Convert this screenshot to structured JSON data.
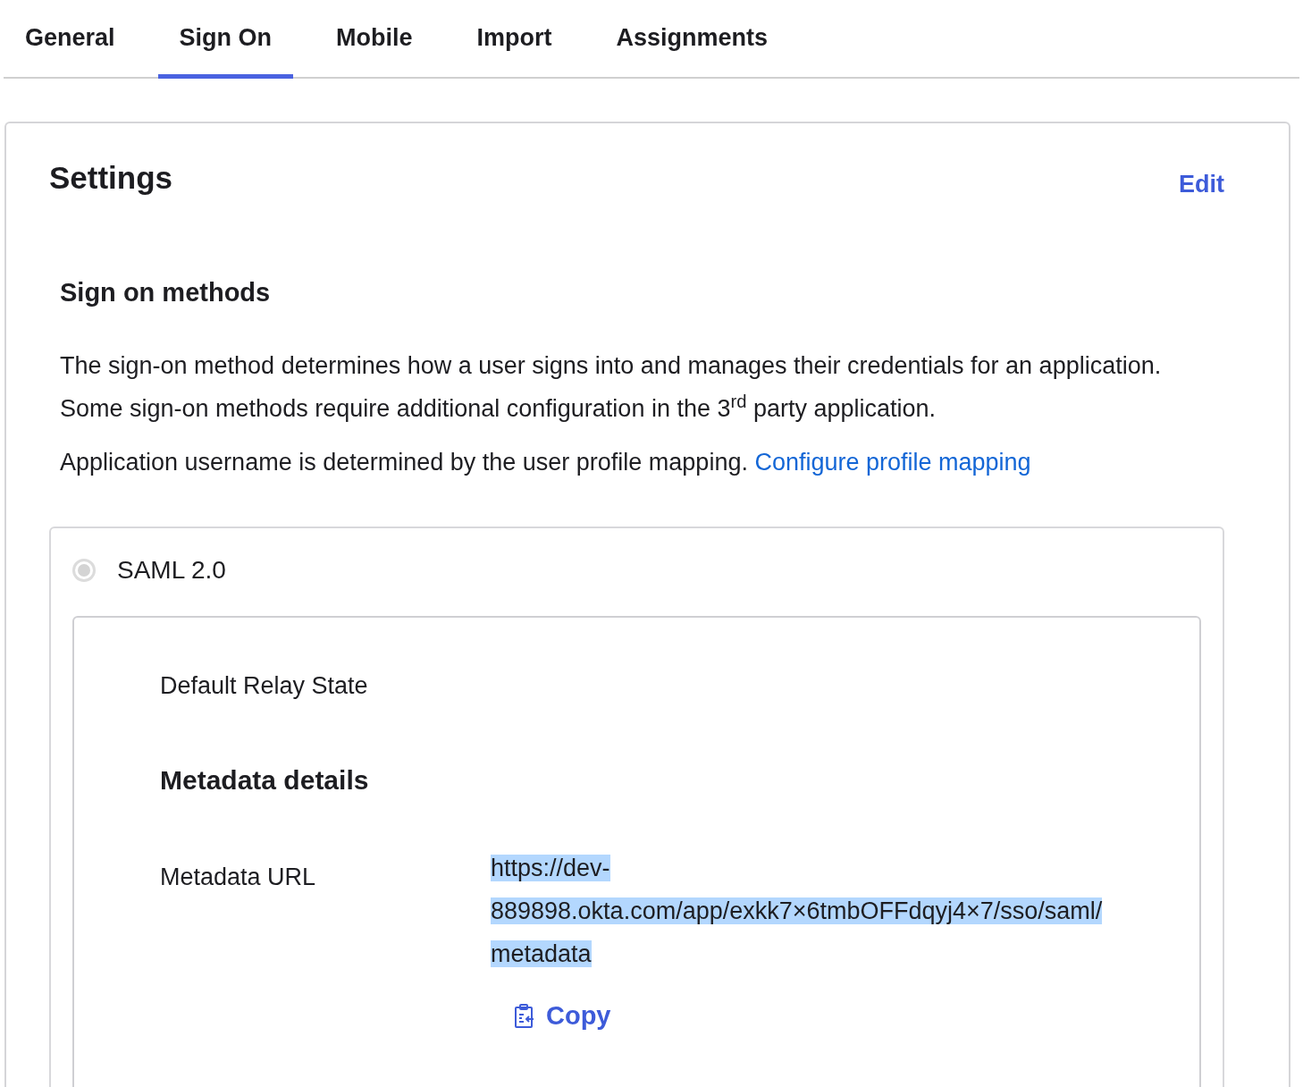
{
  "tabs": [
    {
      "label": "General",
      "selected": false
    },
    {
      "label": "Sign On",
      "selected": true
    },
    {
      "label": "Mobile",
      "selected": false
    },
    {
      "label": "Import",
      "selected": false
    },
    {
      "label": "Assignments",
      "selected": false
    }
  ],
  "settings": {
    "title": "Settings",
    "edit_link": "Edit",
    "section_title": "Sign on methods",
    "description": "The sign-on method determines how a user signs into and manages their credentials for an application. Some sign-on methods require additional configuration in the 3$^{rd}$ party application.",
    "mapping_text": "Application username is determined by the user profile mapping.",
    "mapping_link": "Configure profile mapping",
    "methods": [
      {
        "label": "SAML 2.0",
        "selected": true,
        "disabled": true
      }
    ],
    "relay_state_label": "Default Relay State",
    "metadata_title": "Metadata details",
    "metadata_url_label": "Metadata URL",
    "metadata_url": "https://dev-889898.okta.com/app/exkk7×6tmbOFFdqyj4×7/sso/saml/metadata",
    "metadata_url_highlighted": true,
    "copy_button": "Copy"
  }
}
